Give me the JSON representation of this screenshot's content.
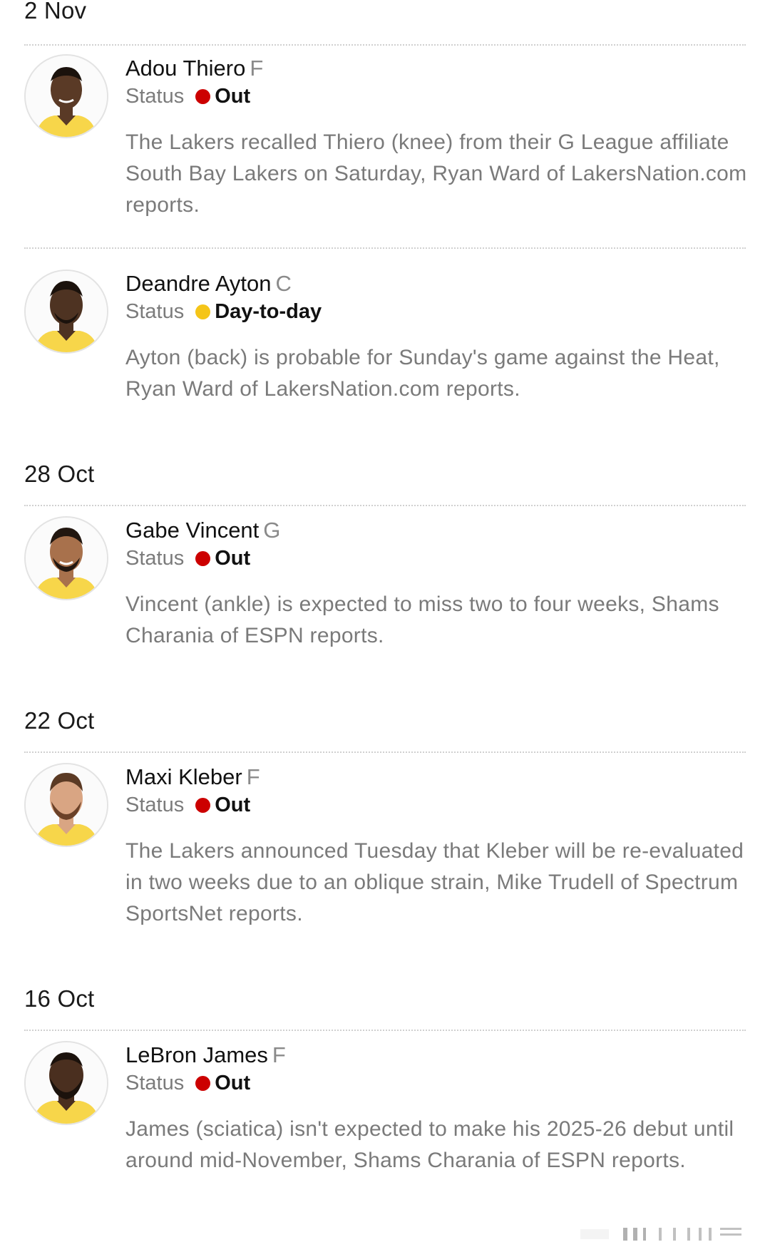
{
  "sections": [
    {
      "date": "2 Nov",
      "entries": [
        {
          "name": "Adou Thiero",
          "position": "F",
          "status_label": "Status",
          "status": "Out",
          "status_color": "#cc0000",
          "description": "The Lakers recalled Thiero (knee) from their G League affiliate South Bay Lakers on Saturday, Ryan Ward of LakersNation.com reports.",
          "avatar_icon": "player-headshot-icon"
        },
        {
          "name": "Deandre Ayton",
          "position": "C",
          "status_label": "Status",
          "status": "Day-to-day",
          "status_color": "#f5c518",
          "description": "Ayton (back) is probable for Sunday's game against the Heat, Ryan Ward of LakersNation.com reports.",
          "avatar_icon": "player-headshot-icon"
        }
      ]
    },
    {
      "date": "28 Oct",
      "entries": [
        {
          "name": "Gabe Vincent",
          "position": "G",
          "status_label": "Status",
          "status": "Out",
          "status_color": "#cc0000",
          "description": "Vincent (ankle) is expected to miss two to four weeks, Shams Charania of ESPN reports.",
          "avatar_icon": "player-headshot-icon"
        }
      ]
    },
    {
      "date": "22 Oct",
      "entries": [
        {
          "name": "Maxi Kleber",
          "position": "F",
          "status_label": "Status",
          "status": "Out",
          "status_color": "#cc0000",
          "description": "The Lakers announced Tuesday that Kleber will be re-evaluated in two weeks due to an oblique strain, Mike Trudell of Spectrum SportsNet reports.",
          "avatar_icon": "player-headshot-icon"
        }
      ]
    },
    {
      "date": "16 Oct",
      "entries": [
        {
          "name": "LeBron James",
          "position": "F",
          "status_label": "Status",
          "status": "Out",
          "status_color": "#cc0000",
          "description": "James (sciatica) isn't expected to make his 2025-26 debut until around mid-November, Shams Charania of ESPN reports.",
          "avatar_icon": "player-headshot-icon"
        }
      ]
    }
  ],
  "colors": {
    "jersey": "#f7d64a",
    "skin_dark": "#5a3a26",
    "skin_medium": "#8a5a3c",
    "skin_light": "#c8946f",
    "text_muted": "#7a7a7a",
    "divider": "#d0d0d0"
  }
}
